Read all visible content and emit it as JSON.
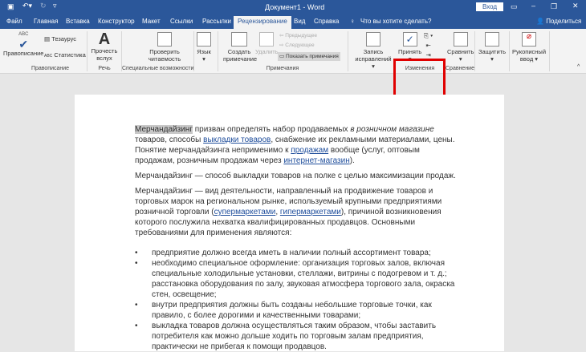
{
  "titlebar": {
    "title": "Документ1 - Word",
    "signin": "Вход",
    "icons": [
      "save-icon",
      "undo-icon",
      "redo-icon",
      "customize-icon",
      "ribbon-display-icon",
      "minimize-icon",
      "restore-icon",
      "close-icon"
    ]
  },
  "tabs": [
    "Файл",
    "Главная",
    "Вставка",
    "Конструктор",
    "Макет",
    "Ссылки",
    "Рассылки",
    "Рецензирование",
    "Вид",
    "Справка"
  ],
  "tell_me": "Что вы хотите сделать?",
  "share": "Поделиться",
  "ribbon": {
    "spelling": "Правописание",
    "thesaurus": "Тезаурус",
    "stats": "Статистика",
    "abc": "ABC",
    "g_spelling": "Правописание",
    "read_aloud": "Прочесть вслух",
    "g_speech": "Речь",
    "check_access": "Проверить читаемость",
    "g_access": "Специальные возможности",
    "language": "Язык",
    "new_comment": "Создать примечание",
    "delete": "Удалить",
    "previous": "Предыдущее",
    "next": "Следующее",
    "show_comments": "Показать примечания",
    "g_comments": "Примечания",
    "track": "Запись исправлений",
    "accept": "Принять",
    "g_changes": "Изменения",
    "compare": "Сравнить",
    "g_compare": "Сравнение",
    "protect": "Защитить",
    "ink": "Рукописный ввод"
  },
  "highlight_color": "#e00000",
  "doc": {
    "p1": {
      "hl": "Мерчандайзинг",
      "t1": " призван определять набор продаваемых ",
      "em": "в розничном магазине",
      "t2": " товаров, способы ",
      "l1": "выкладки товаров",
      "t3": ", снабжение их рекламными материалами, цены. Понятие мерчандайзинга неприменимо к ",
      "l2": "продажам",
      "t4": " вообще (услуг, оптовым продажам, розничным продажам через ",
      "l3": "интернет-магазин",
      "t5": ")."
    },
    "p2": "Мерчандайзинг — способ выкладки товаров на полке с целью максимизации продаж.",
    "p3": {
      "t1": "Мерчандайзинг — вид деятельности, направленный на продвижение товаров и торговых марок на региональном рынке, используемый крупными предприятиями розничной торговли (",
      "l1": "супермаркетами",
      "t2": ", ",
      "l2": "гипермаркетами",
      "t3": "), причиной возникновения которого послужила нехватка квалифицированных продавцов. Основными требованиями для применения являются:"
    },
    "bullets": [
      "предприятие должно всегда иметь в наличии полный ассортимент товара;",
      "необходимо специальное оформление: организация торговых залов, включая специальные холодильные установки, стеллажи, витрины с подогревом и т. д.; расстановка оборудования по залу, звуковая атмосфера торгового зала, окраска стен, освещение;",
      "внутри предприятия должны быть созданы небольшие торговые точки, как правило, с более дорогими и качественными товарами;",
      "выкладка товаров должна осуществляться таким образом, чтобы заставить потребителя как можно дольше ходить по торговым залам предприятия, практически не прибегая к помощи продавцов."
    ]
  }
}
